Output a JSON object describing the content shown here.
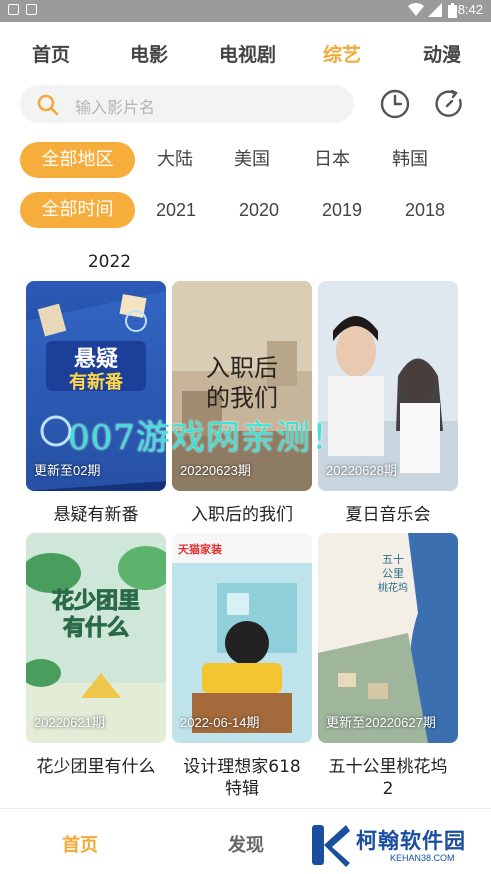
{
  "status_bar": {
    "time": "8:42"
  },
  "top_tabs": [
    "首页",
    "电影",
    "电视剧",
    "综艺",
    "动漫"
  ],
  "active_top_tab": "综艺",
  "search": {
    "placeholder": "输入影片名"
  },
  "icons": {
    "history": "clock-icon",
    "refresh": "refresh-icon",
    "search": "search-icon"
  },
  "region_filters": [
    "全部地区",
    "大陆",
    "美国",
    "日本",
    "韩国"
  ],
  "year_filters": [
    "全部时间",
    "2021",
    "2020",
    "2019",
    "2018"
  ],
  "partial_year_label": "2022",
  "cards": [
    {
      "title": "悬疑有新番",
      "badge": "更新至02期"
    },
    {
      "title": "入职后的我们",
      "badge": "20220623期"
    },
    {
      "title": "夏日音乐会",
      "badge": "20220628期"
    },
    {
      "title": "花少团里有什么",
      "badge": "20220621期"
    },
    {
      "title": "设计理想家618特辑",
      "title_line1": "设计理想家618",
      "title_line2": "特辑",
      "badge": "2022-06-14期"
    },
    {
      "title": "五十公里桃花坞2",
      "title_line1": "五十公里桃花坞",
      "title_line2": "2",
      "badge": "更新至20220627期"
    }
  ],
  "watermark": "007游戏网亲测！",
  "bottom_tabs": [
    "首页",
    "发现"
  ],
  "logo": {
    "name": "柯翰软件园",
    "url": "KEHAN38.COM"
  },
  "colors": {
    "accent": "#f6ad3c",
    "watermark": "#3fe0d6",
    "logo": "#1a4fa0"
  }
}
